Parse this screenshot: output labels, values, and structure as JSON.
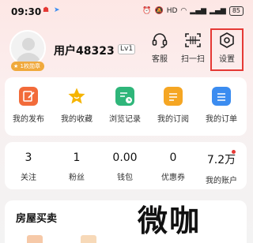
{
  "status": {
    "time": "09:30",
    "battery": "85",
    "net": "HD"
  },
  "profile": {
    "username": "用户48323",
    "level": "Lv1",
    "badge": "1枚勋章"
  },
  "header_actions": [
    {
      "label": "客服",
      "icon": "headset-icon"
    },
    {
      "label": "扫一扫",
      "icon": "scan-icon"
    },
    {
      "label": "设置",
      "icon": "settings-icon"
    }
  ],
  "quick_actions": [
    {
      "label": "我的发布",
      "icon": "publish-icon",
      "color": "#f26b3a"
    },
    {
      "label": "我的收藏",
      "icon": "star-icon",
      "color": "#f5b400"
    },
    {
      "label": "浏览记录",
      "icon": "history-icon",
      "color": "#2fb67a"
    },
    {
      "label": "我的订阅",
      "icon": "subscribe-icon",
      "color": "#f5a623"
    },
    {
      "label": "我的订单",
      "icon": "order-icon",
      "color": "#3b8cf0"
    }
  ],
  "stats": [
    {
      "value": "3",
      "label": "关注"
    },
    {
      "value": "1",
      "label": "粉丝"
    },
    {
      "value": "0.00",
      "label": "钱包"
    },
    {
      "value": "0",
      "label": "优惠券"
    },
    {
      "value": "7.2万",
      "label": "我的账户"
    }
  ],
  "section": {
    "title": "房屋买卖"
  },
  "watermark": "微咖",
  "colors": {
    "highlight": "#e53935",
    "background_top": "#fde7e5"
  }
}
